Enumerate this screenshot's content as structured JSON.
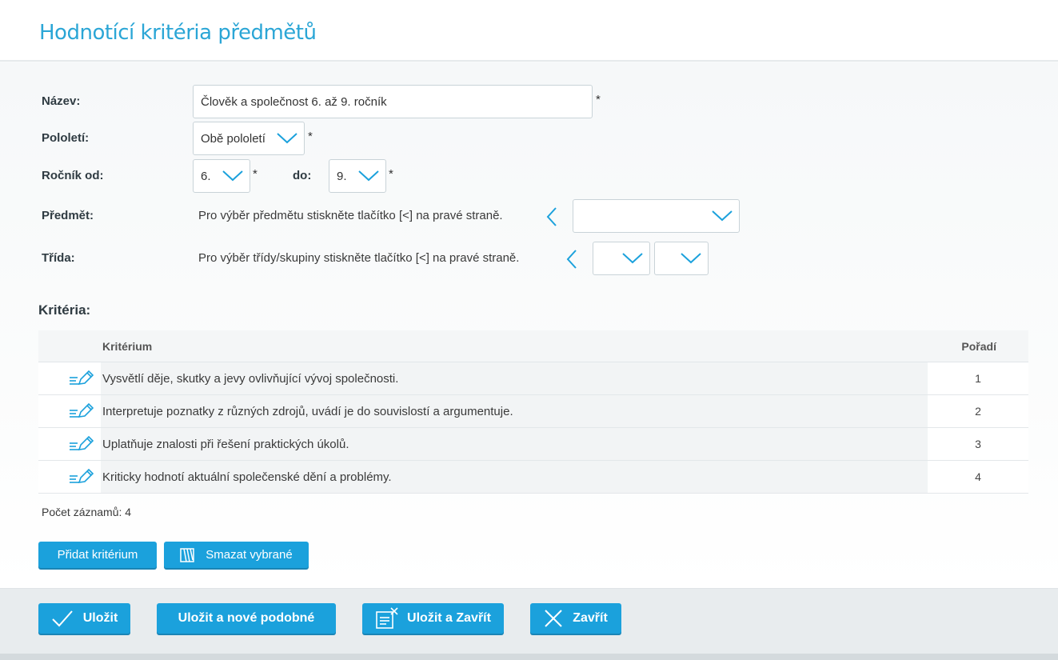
{
  "page": {
    "title": "Hodnotící kritéria předmětů"
  },
  "form": {
    "name_label": "Název:",
    "name_value": "Člověk a společnost 6. až 9. ročník",
    "required": "*",
    "semester_label": "Pololetí:",
    "semester_value": "Obě pololetí",
    "grade_from_label": "Ročník od:",
    "grade_from_value": "6.",
    "grade_to_label": "do:",
    "grade_to_value": "9.",
    "subject_label": "Předmět:",
    "subject_hint": "Pro výběr předmětu stiskněte tlačítko [<] na pravé straně.",
    "subject_value": "",
    "class_label": "Třída:",
    "class_hint": "Pro výběr třídy/skupiny stiskněte tlačítko [<] na pravé straně.",
    "class_value": "",
    "group_value": ""
  },
  "criteria": {
    "title": "Kritéria:",
    "columns": {
      "criterion": "Kritérium",
      "order": "Pořadí"
    },
    "rows": [
      {
        "text": "Vysvětlí děje, skutky a jevy ovlivňující vývoj společnosti.",
        "order": "1"
      },
      {
        "text": "Interpretuje poznatky z různých zdrojů, uvádí je do souvislostí a argumentuje.",
        "order": "2"
      },
      {
        "text": "Uplatňuje znalosti při řešení praktických úkolů.",
        "order": "3"
      },
      {
        "text": "Kriticky hodnotí aktuální společenské dění a problémy.",
        "order": "4"
      }
    ],
    "count": "Počet záznamů: 4",
    "add_label": "Přidat kritérium",
    "delete_label": "Smazat vybrané"
  },
  "footer": {
    "save": "Uložit",
    "save_new": "Uložit a nové podobné",
    "save_close": "Uložit a Zavřít",
    "close": "Zavřít"
  },
  "colors": {
    "accent": "#1ba1dc",
    "title": "#2ba6d6"
  },
  "icons": [
    "chevron-down-icon",
    "chevron-left-icon",
    "edit-pencil-icon",
    "delete-icon",
    "check-icon",
    "save-close-icon",
    "close-icon"
  ]
}
